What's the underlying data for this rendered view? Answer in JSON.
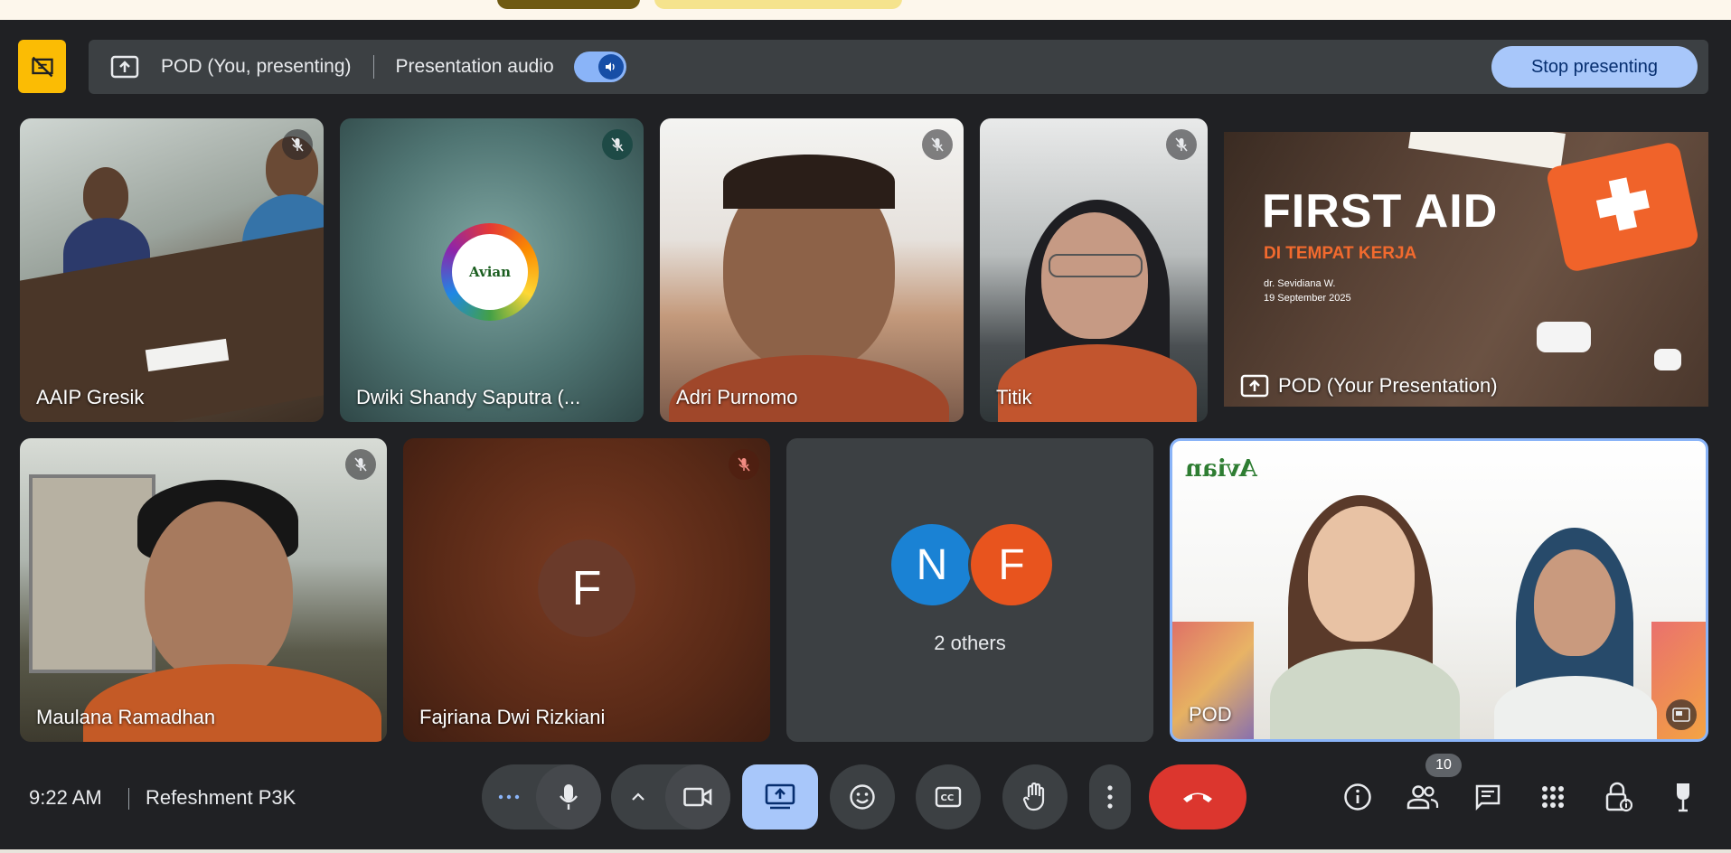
{
  "presenting_bar": {
    "presenter_label": "POD (You, presenting)",
    "audio_label": "Presentation audio",
    "stop_button_label": "Stop presenting",
    "audio_enabled": true
  },
  "tiles": {
    "t1": {
      "name": "AAIP Gresik",
      "muted": true
    },
    "t2": {
      "name": "Dwiki Shandy Saputra (...",
      "muted": true,
      "logo_text": "Avian"
    },
    "t3": {
      "name": "Adri Purnomo",
      "muted": true
    },
    "t4": {
      "name": "Titik",
      "muted": true
    },
    "t5": {
      "name": "POD (Your Presentation)",
      "slide": {
        "title": "FIRST AID",
        "subtitle": "DI TEMPAT KERJA",
        "author": "dr. Sevidiana W.",
        "date": "19 September 2025"
      }
    },
    "t6": {
      "name": "Maulana Ramadhan",
      "muted": true
    },
    "t7": {
      "name": "Fajriana Dwi Rizkiani",
      "muted": true,
      "avatar_letter": "F"
    },
    "t8": {
      "avatars": [
        "N",
        "F"
      ],
      "label": "2 others"
    },
    "t9": {
      "name": "POD",
      "logo_text": "Avian"
    }
  },
  "bottom_bar": {
    "time": "9:22 AM",
    "meeting_name": "Refeshment P3K",
    "people_count": "10"
  },
  "colors": {
    "background": "#202124",
    "surface": "#3c4043",
    "accent_blue": "#a8c7fa",
    "present_yellow": "#fbbc04",
    "leave_red": "#dc362e",
    "avatar_n": "#1a82d4",
    "avatar_f": "#e8541e"
  }
}
